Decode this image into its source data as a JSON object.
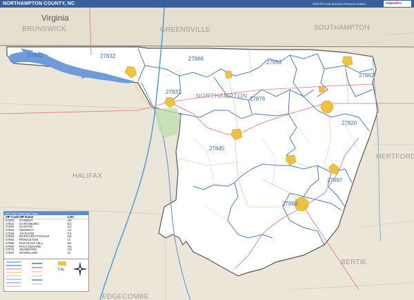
{
  "header": {
    "title": "NORTHAMPTON COUNTY, NC",
    "edition": "2026 ZIP Code Business Reference Edition",
    "logo_text": "mapsales"
  },
  "colors": {
    "county_fill": "#ffffff",
    "surrounding_fill": "#ece6d8",
    "virginia_fill": "#e4dfcf",
    "water": "#6f9bd8",
    "zip_border": "#4a7cc4",
    "highway": "#5aa0d8",
    "road_red": "#e07080",
    "city_fill": "#f0c040",
    "header_bg": "#3a5f9c"
  },
  "map": {
    "state_label": "Virginia",
    "county_label": "NORTHAMPTON",
    "region_labels": {
      "brunswick": "BRUNSWICK",
      "greensville": "GREENSVILLE",
      "southampton": "SOUTHAMPTON",
      "hertford": "HERTFORD",
      "halifax": "HALIFAX",
      "bertie": "BERTIE",
      "edgecombe": "EDGECOMBE"
    },
    "zip_labels": {
      "z27842": "27842",
      "z27832": "27832",
      "z27866": "27866",
      "z27853": "27853",
      "z27862": "27862",
      "z27831": "27831",
      "z27876": "27876",
      "z27820": "27820",
      "z27845": "27845",
      "z27897": "27897",
      "z27869": "27869"
    }
  },
  "legend": {
    "header": "ZIP Code Reference Index",
    "columns": [
      "ZIP Code",
      "ZIP Name",
      "LOC"
    ],
    "rows": [
      {
        "zip": "27820",
        "name": "CONWAY",
        "loc": "H3"
      },
      {
        "zip": "27831",
        "name": "GARYSBURG",
        "loc": "E2"
      },
      {
        "zip": "27832",
        "name": "GASTON",
        "loc": "C2"
      },
      {
        "zip": "27842",
        "name": "HENRICO",
        "loc": "A2"
      },
      {
        "zip": "27845",
        "name": "JACKSON",
        "loc": "F4"
      },
      {
        "zip": "27853",
        "name": "MARGARETTSVILLE",
        "loc": "H2"
      },
      {
        "zip": "27862",
        "name": "PENDLETON",
        "loc": "I2"
      },
      {
        "zip": "27866",
        "name": "PLEASANT HILL",
        "loc": "E2"
      },
      {
        "zip": "27869",
        "name": "RICH SQUARE",
        "loc": "H5"
      },
      {
        "zip": "27876",
        "name": "SEABOARD",
        "loc": "G2"
      },
      {
        "zip": "27897",
        "name": "WOODLAND",
        "loc": "I4"
      }
    ]
  },
  "key": {
    "city_label": "City"
  }
}
